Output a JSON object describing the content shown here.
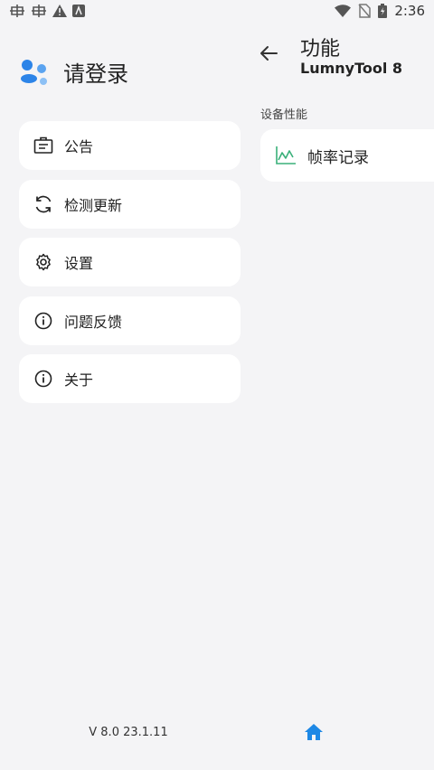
{
  "status_bar": {
    "time": "2:36",
    "left_icons": [
      "bug-icon",
      "bug-icon",
      "warning-icon",
      "app-icon"
    ],
    "right_icons": [
      "wifi-icon",
      "no-sim-icon",
      "battery-charging-icon"
    ]
  },
  "drawer": {
    "login_label": "请登录",
    "menu": [
      {
        "label": "公告",
        "icon": "announcement-icon"
      },
      {
        "label": "检测更新",
        "icon": "refresh-icon"
      },
      {
        "label": "设置",
        "icon": "gear-icon"
      },
      {
        "label": "问题反馈",
        "icon": "info-icon"
      },
      {
        "label": "关于",
        "icon": "info-icon"
      }
    ],
    "version": "V 8.0 23.1.11"
  },
  "panel": {
    "title": "功能",
    "subtitle": "LumnyTool 8",
    "section_label": "设备性能",
    "feature_label": "帧率记录",
    "feature_icon": "line-chart-icon",
    "accent_color": "#3ab07a",
    "home_color": "#1e88e5"
  }
}
